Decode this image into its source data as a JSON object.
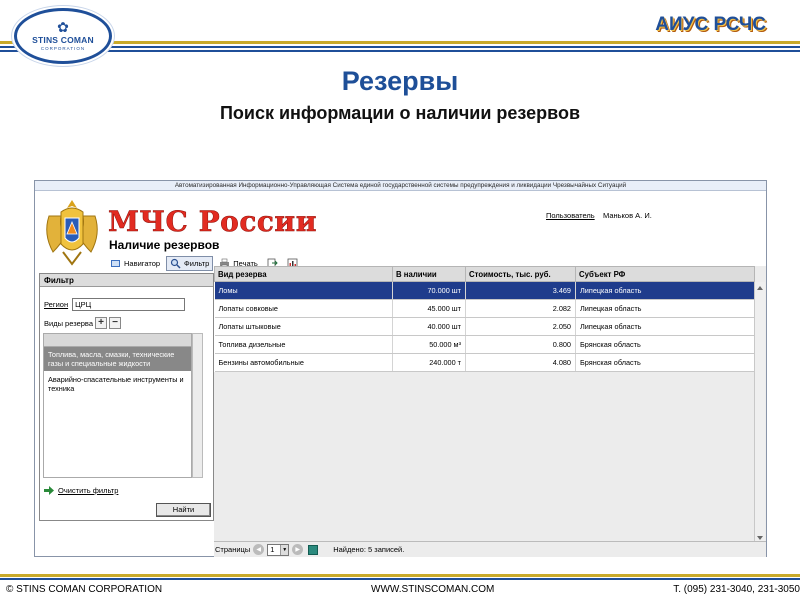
{
  "slide": {
    "app_name": "АИУС РСЧС",
    "logo_name": "STINS COMAN",
    "logo_sub": "CORPORATION",
    "title": "Резервы",
    "subtitle": "Поиск информации о наличии резервов"
  },
  "app": {
    "banner": "Автоматизированная Информационно-Управляющая Система единой государственной системы предупреждения и ликвидации Чрезвычайных Ситуаций",
    "brand": "МЧС России",
    "page_name": "Наличие резервов",
    "user_label": "Пользователь",
    "user_name": "Маньков А. И.",
    "toolbar": {
      "navigator": "Навигатор",
      "filter": "Фильтр",
      "print": "Печать"
    }
  },
  "filter": {
    "header": "Фильтр",
    "region_label": "Регион",
    "region_value": "ЦРЦ",
    "types_label": "Виды резерва",
    "types": [
      {
        "label": "Топлива, масла, смазки, технические газы и специальные жидкости",
        "selected": true
      },
      {
        "label": "Аварийно-спасательные инструменты и техника",
        "selected": false
      }
    ],
    "clear_label": "Очистить фильтр",
    "find_label": "Найти"
  },
  "grid": {
    "columns": [
      "Вид резерва",
      "В наличии",
      "Стоимость, тыс. руб.",
      "Субъект РФ"
    ],
    "rows": [
      {
        "type": "Ломы",
        "qty": "70.000 шт",
        "cost": "3.469",
        "region": "Липецкая область",
        "selected": true
      },
      {
        "type": "Лопаты совковые",
        "qty": "45.000 шт",
        "cost": "2.082",
        "region": "Липецкая область",
        "selected": false
      },
      {
        "type": "Лопаты штыковые",
        "qty": "40.000 шт",
        "cost": "2.050",
        "region": "Липецкая область",
        "selected": false
      },
      {
        "type": "Топлива дизельные",
        "qty": "50.000 м³",
        "cost": "0.800",
        "region": "Брянская область",
        "selected": false
      },
      {
        "type": "Бензины автомобильные",
        "qty": "240.000 т",
        "cost": "4.080",
        "region": "Брянская область",
        "selected": false
      }
    ]
  },
  "status": {
    "pages_label": "Страницы",
    "page_value": "1",
    "found_text": "Найдено: 5 записей."
  },
  "footer": {
    "left": "© STINS COMAN CORPORATION",
    "middle": "WWW.STINSCOMAN.COM",
    "right": "Т. (095) 231-3040, 231-3050"
  },
  "colors": {
    "brand_blue": "#1f4f99",
    "gold": "#c9aa2a",
    "mchs_red": "#e22b21",
    "selection": "#1f3c8c"
  }
}
